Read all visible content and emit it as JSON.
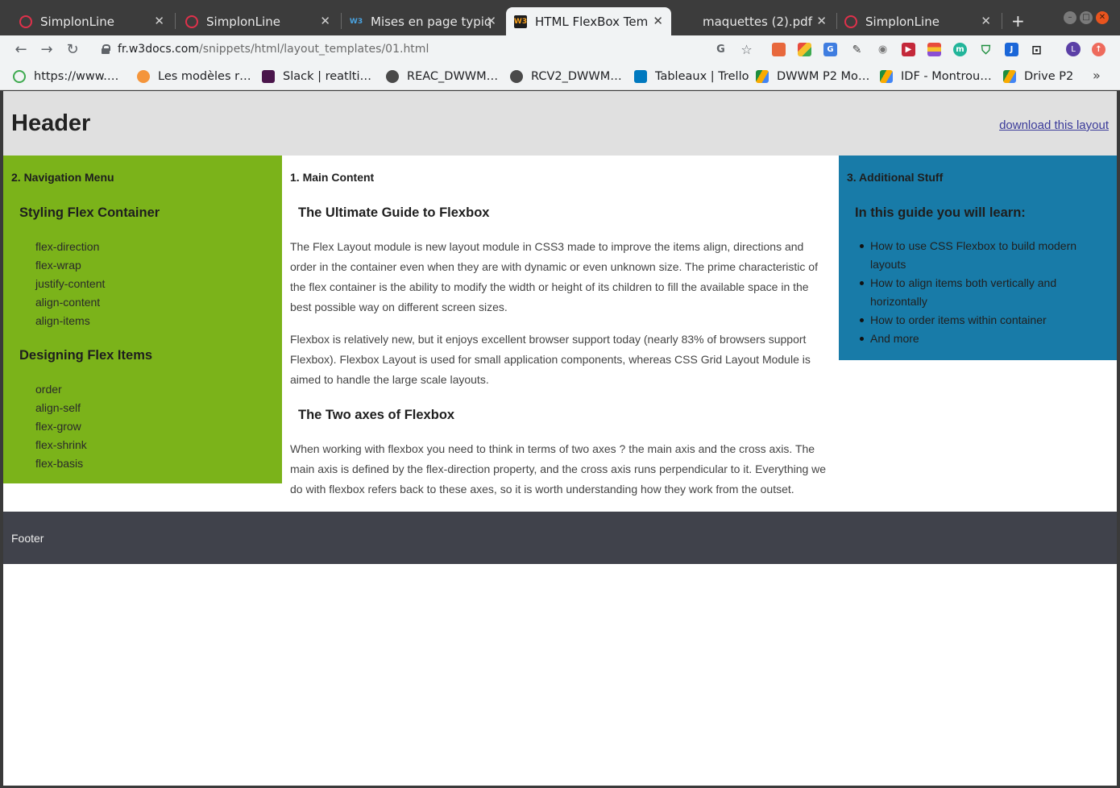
{
  "browser": {
    "tabs": [
      {
        "title": "SimplonLine",
        "favicon": "simplon-icon"
      },
      {
        "title": "SimplonLine",
        "favicon": "simplon-icon"
      },
      {
        "title": "Mises en page typiqu",
        "favicon": "w3docs-icon"
      },
      {
        "title": "HTML FlexBox Temp",
        "favicon": "w3docs-icon",
        "active": true
      },
      {
        "title": "maquettes (2).pdf",
        "favicon": "pdf-icon"
      },
      {
        "title": "SimplonLine",
        "favicon": "simplon-icon"
      }
    ],
    "new_tab": "+",
    "url_host": "fr.w3docs.com",
    "url_path": "/snippets/html/layout_templates/01.html",
    "profile_initial": "L",
    "bookmarks": [
      {
        "label": "https://www.…"
      },
      {
        "label": "Les modèles r…"
      },
      {
        "label": "Slack | reatlti…"
      },
      {
        "label": "REAC_DWWM…"
      },
      {
        "label": "RCV2_DWWM…"
      },
      {
        "label": "Tableaux | Trello"
      },
      {
        "label": "DWWM P2 Mo…"
      },
      {
        "label": "IDF - Montrou…"
      },
      {
        "label": "Drive P2"
      }
    ],
    "bookmarks_more": "»"
  },
  "page": {
    "header_title": "Header",
    "download_link": "download this layout",
    "nav": {
      "title": "2. Navigation Menu",
      "section1": "Styling Flex Container",
      "links1": [
        "flex-direction",
        "flex-wrap",
        "justify-content",
        "align-content",
        "align-items"
      ],
      "section2": "Designing Flex Items",
      "links2": [
        "order",
        "align-self",
        "flex-grow",
        "flex-shrink",
        "flex-basis"
      ]
    },
    "main": {
      "title": "1. Main Content",
      "h1": "The Ultimate Guide to Flexbox",
      "p1": "The Flex Layout module is new layout module in CSS3 made to improve the items align, directions and order in the container even when they are with dynamic or even unknown size. The prime characteristic of the flex container is the ability to modify the width or height of its children to fill the available space in the best possible way on different screen sizes.",
      "p2": "Flexbox is relatively new, but it enjoys excellent browser support today (nearly 83% of browsers support Flexbox). Flexbox Layout is used for small application components, whereas CSS Grid Layout Module is aimed to handle the large scale layouts.",
      "h2": "The Two axes of Flexbox",
      "p3": "When working with flexbox you need to think in terms of two axes ? the main axis and the cross axis. The main axis is defined by the flex-direction property, and the cross axis runs perpendicular to it. Everything we do with flexbox refers back to these axes, so it is worth understanding how they work from the outset."
    },
    "extra": {
      "title": "3. Additional Stuff",
      "heading": "In this guide you will learn:",
      "items": [
        "How to use CSS Flexbox to build modern layouts",
        "How to align items both vertically and horizontally",
        "How to order items within container",
        "And more"
      ]
    },
    "footer": "Footer"
  },
  "colors": {
    "header_bg": "#e0e0e0",
    "nav_bg": "#7bb31a",
    "extra_bg": "#187ba8",
    "footer_bg": "#40424b"
  }
}
